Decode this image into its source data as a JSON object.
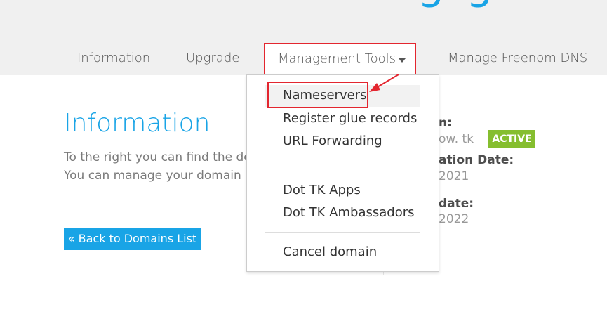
{
  "header": {
    "logo_fragment": "g g",
    "tabs": [
      {
        "label": "Information"
      },
      {
        "label": "Upgrade"
      },
      {
        "label": "Management Tools"
      },
      {
        "label": "Manage Freenom DNS"
      }
    ]
  },
  "dropdown": {
    "items": [
      {
        "label": "Nameservers"
      },
      {
        "label": "Register glue records"
      },
      {
        "label": "URL Forwarding"
      },
      {
        "label": "Dot TK Apps"
      },
      {
        "label": "Dot TK Ambassadors"
      },
      {
        "label": "Cancel domain"
      }
    ]
  },
  "main": {
    "title": "Information",
    "line1": "To the right you can find the deta",
    "line2": "You can manage your domain usi",
    "back_button": "« Back to Domains List"
  },
  "right": {
    "domain_label": "n:",
    "domain_value": "ow.  tk",
    "status": "ACTIVE",
    "reg_label": "ation Date:",
    "reg_value": "2021",
    "exp_label": "date:",
    "exp_value": "2022"
  },
  "colors": {
    "accent": "#19a4e6",
    "highlight_red": "#e3262f",
    "active_badge": "#85be2f"
  }
}
